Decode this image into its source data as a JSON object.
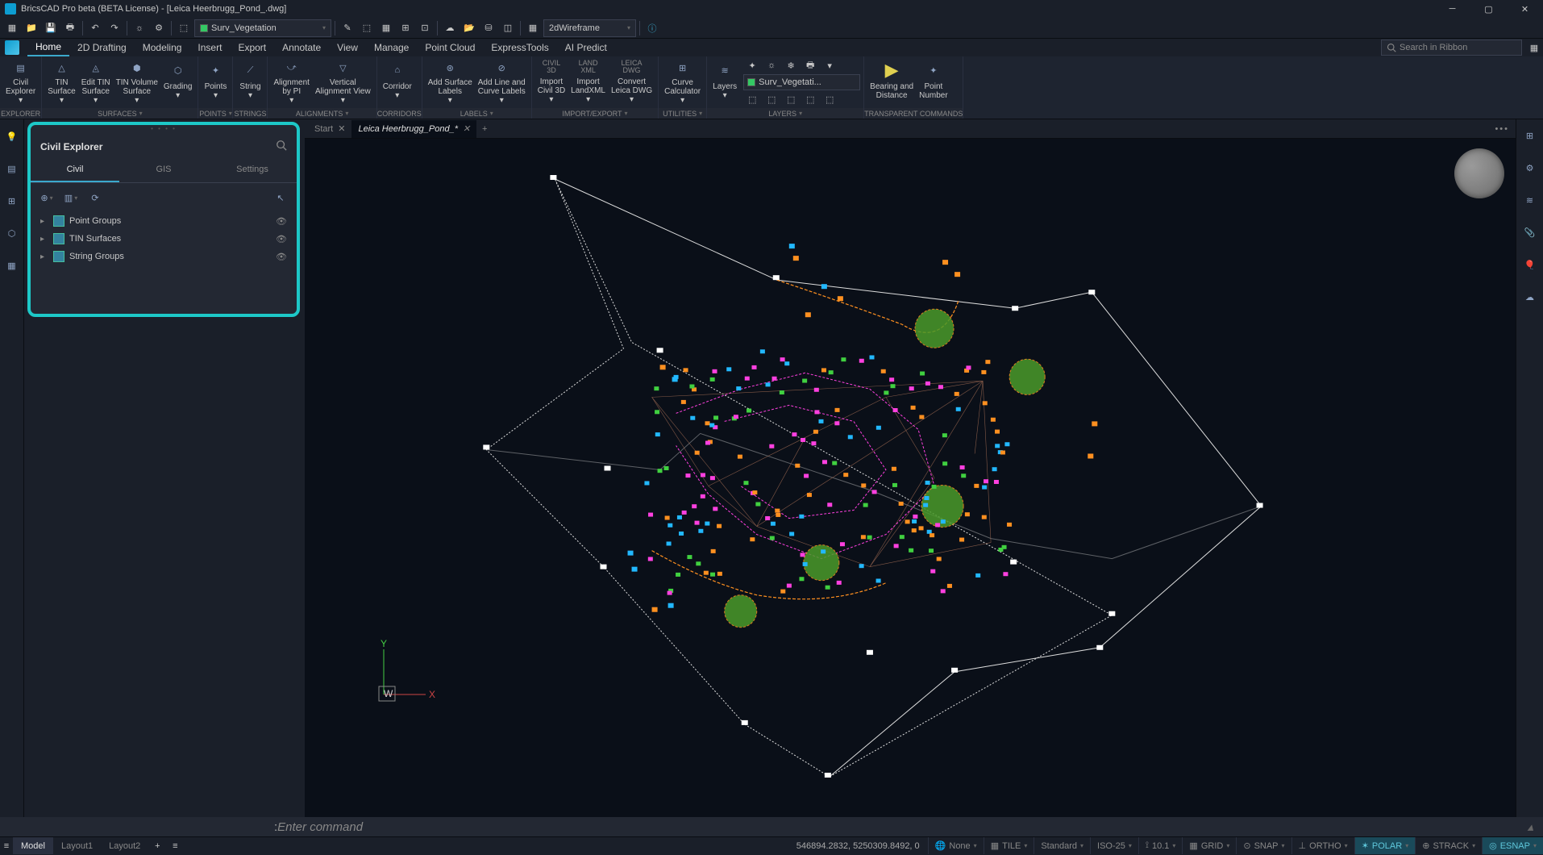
{
  "app": {
    "title": "BricsCAD Pro beta (BETA License) - [Leica Heerbrugg_Pond_.dwg]"
  },
  "quick_access": {
    "layer_dropdown": "Surv_Vegetation",
    "style_dropdown": "2dWireframe"
  },
  "menu": {
    "items": [
      "Home",
      "2D Drafting",
      "Modeling",
      "Insert",
      "Export",
      "Annotate",
      "View",
      "Manage",
      "Point Cloud",
      "ExpressTools",
      "AI Predict"
    ],
    "active": "Home",
    "search_placeholder": "Search in Ribbon"
  },
  "ribbon": {
    "groups": [
      {
        "label": "EXPLORER",
        "items": [
          {
            "label": "Civil\nExplorer"
          }
        ]
      },
      {
        "label": "SURFACES",
        "items": [
          {
            "label": "TIN\nSurface"
          },
          {
            "label": "Edit TIN\nSurface"
          },
          {
            "label": "TIN Volume\nSurface"
          },
          {
            "label": "Grading"
          }
        ]
      },
      {
        "label": "POINTS",
        "items": [
          {
            "label": "Points"
          }
        ]
      },
      {
        "label": "STRINGS",
        "items": [
          {
            "label": "String"
          }
        ]
      },
      {
        "label": "ALIGNMENTS",
        "items": [
          {
            "label": "Alignment\nby PI"
          },
          {
            "label": "Vertical\nAlignment View"
          }
        ]
      },
      {
        "label": "CORRIDORS",
        "items": [
          {
            "label": "Corridor"
          }
        ]
      },
      {
        "label": "LABELS",
        "items": [
          {
            "label": "Add Surface\nLabels"
          },
          {
            "label": "Add Line and\nCurve Labels"
          }
        ]
      },
      {
        "label": "IMPORT/EXPORT",
        "items": [
          {
            "label": "CIVIL\n3D",
            "sub": "Import\nCivil 3D"
          },
          {
            "label": "LAND\nXML",
            "sub": "Import\nLandXML"
          },
          {
            "label": "LEICA\nDWG",
            "sub": "Convert\nLeica DWG"
          }
        ]
      },
      {
        "label": "UTILITIES",
        "items": [
          {
            "label": "Curve\nCalculator"
          }
        ]
      },
      {
        "label": "LAYERS",
        "items": [
          {
            "label": "Layers"
          }
        ],
        "layer_value": "Surv_Vegetati..."
      },
      {
        "label": "TRANSPARENT COMMANDS",
        "items": [
          {
            "label": "Bearing and\nDistance"
          },
          {
            "label": "Point\nNumber"
          }
        ]
      }
    ]
  },
  "civil_explorer": {
    "title": "Civil Explorer",
    "tabs": [
      "Civil",
      "GIS",
      "Settings"
    ],
    "active_tab": "Civil",
    "tree": [
      {
        "label": "Point Groups"
      },
      {
        "label": "TIN Surfaces"
      },
      {
        "label": "String Groups"
      }
    ]
  },
  "doc_tabs": {
    "tabs": [
      {
        "label": "Start",
        "active": false
      },
      {
        "label": "Leica Heerbrugg_Pond_*",
        "active": true
      }
    ]
  },
  "ucs": {
    "x": "X",
    "y": "Y",
    "w": "W"
  },
  "command": {
    "prompt": ": ",
    "placeholder": "Enter command"
  },
  "layout_tabs": {
    "tabs": [
      "Model",
      "Layout1",
      "Layout2"
    ],
    "active": "Model"
  },
  "status": {
    "coords": "546894.2832, 5250309.8492, 0",
    "segments": [
      {
        "label": "None",
        "icon": "globe"
      },
      {
        "label": "TILE",
        "icon": "tile"
      },
      {
        "label": "Standard"
      },
      {
        "label": "ISO-25"
      },
      {
        "label": "10.1",
        "icon": "scale"
      },
      {
        "label": "GRID",
        "icon": "grid"
      },
      {
        "label": "SNAP",
        "icon": "snap"
      },
      {
        "label": "ORTHO",
        "icon": "ortho"
      },
      {
        "label": "POLAR",
        "on": true,
        "icon": "polar"
      },
      {
        "label": "STRACK",
        "icon": "strack"
      },
      {
        "label": "ESNAP",
        "on": true,
        "icon": "esnap"
      }
    ]
  }
}
